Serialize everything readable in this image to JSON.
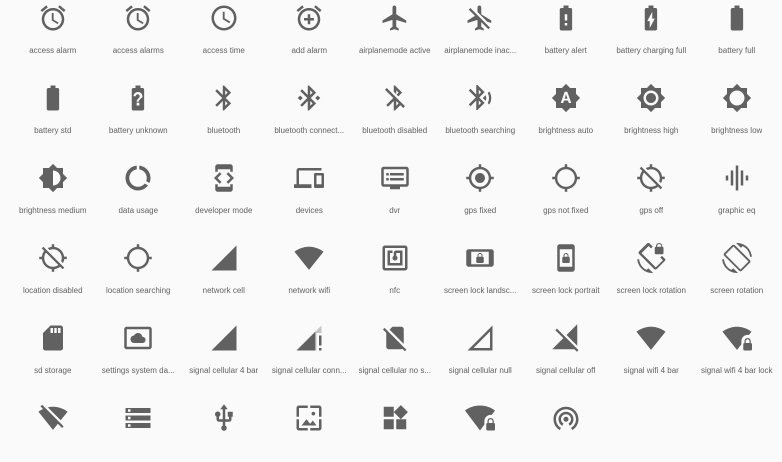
{
  "icons": [
    {
      "label": "access alarm",
      "icon": "alarm-icon"
    },
    {
      "label": "access alarms",
      "icon": "alarms-icon"
    },
    {
      "label": "access time",
      "icon": "time-icon"
    },
    {
      "label": "add alarm",
      "icon": "add-alarm-icon"
    },
    {
      "label": "airplanemode active",
      "icon": "airplane-icon"
    },
    {
      "label": "airplanemode inac...",
      "icon": "airplane-off-icon"
    },
    {
      "label": "battery alert",
      "icon": "battery-alert-icon"
    },
    {
      "label": "battery charging full",
      "icon": "battery-charging-icon"
    },
    {
      "label": "battery full",
      "icon": "battery-full-icon"
    },
    {
      "label": "battery std",
      "icon": "battery-std-icon"
    },
    {
      "label": "battery unknown",
      "icon": "battery-unknown-icon"
    },
    {
      "label": "bluetooth",
      "icon": "bluetooth-icon"
    },
    {
      "label": "bluetooth connect...",
      "icon": "bluetooth-connected-icon"
    },
    {
      "label": "bluetooth disabled",
      "icon": "bluetooth-disabled-icon"
    },
    {
      "label": "bluetooth searching",
      "icon": "bluetooth-searching-icon"
    },
    {
      "label": "brightness auto",
      "icon": "brightness-auto-icon"
    },
    {
      "label": "brightness high",
      "icon": "brightness-high-icon"
    },
    {
      "label": "brightness low",
      "icon": "brightness-low-icon"
    },
    {
      "label": "brightness medium",
      "icon": "brightness-medium-icon"
    },
    {
      "label": "data usage",
      "icon": "data-usage-icon"
    },
    {
      "label": "developer mode",
      "icon": "developer-mode-icon"
    },
    {
      "label": "devices",
      "icon": "devices-icon"
    },
    {
      "label": "dvr",
      "icon": "dvr-icon"
    },
    {
      "label": "gps fixed",
      "icon": "gps-fixed-icon"
    },
    {
      "label": "gps not fixed",
      "icon": "gps-not-fixed-icon"
    },
    {
      "label": "gps off",
      "icon": "gps-off-icon"
    },
    {
      "label": "graphic eq",
      "icon": "graphic-eq-icon"
    },
    {
      "label": "location disabled",
      "icon": "location-disabled-icon"
    },
    {
      "label": "location searching",
      "icon": "location-searching-icon"
    },
    {
      "label": "network cell",
      "icon": "network-cell-icon"
    },
    {
      "label": "network wifi",
      "icon": "network-wifi-icon"
    },
    {
      "label": "nfc",
      "icon": "nfc-icon"
    },
    {
      "label": "screen lock landsc...",
      "icon": "screen-lock-landscape-icon"
    },
    {
      "label": "screen lock portrait",
      "icon": "screen-lock-portrait-icon"
    },
    {
      "label": "screen lock rotation",
      "icon": "screen-lock-rotation-icon"
    },
    {
      "label": "screen rotation",
      "icon": "screen-rotation-icon"
    },
    {
      "label": "sd storage",
      "icon": "sd-storage-icon"
    },
    {
      "label": "settings system da...",
      "icon": "settings-system-daydream-icon"
    },
    {
      "label": "signal cellular 4 bar",
      "icon": "signal-cellular-4-bar-icon"
    },
    {
      "label": "signal cellular conn...",
      "icon": "signal-cellular-connected-icon"
    },
    {
      "label": "signal cellular no s...",
      "icon": "signal-cellular-no-sim-icon"
    },
    {
      "label": "signal cellular null",
      "icon": "signal-cellular-null-icon"
    },
    {
      "label": "signal cellular off",
      "icon": "signal-cellular-off-icon"
    },
    {
      "label": "signal wifi 4 bar",
      "icon": "signal-wifi-4-bar-icon"
    },
    {
      "label": "signal wifi 4 bar lock",
      "icon": "signal-wifi-4-bar-lock-icon"
    },
    {
      "label": "",
      "icon": "signal-wifi-off-icon"
    },
    {
      "label": "",
      "icon": "storage-icon"
    },
    {
      "label": "",
      "icon": "usb-icon"
    },
    {
      "label": "",
      "icon": "wallpaper-icon"
    },
    {
      "label": "",
      "icon": "widgets-icon"
    },
    {
      "label": "",
      "icon": "wifi-lock-icon"
    },
    {
      "label": "",
      "icon": "wifi-tethering-icon"
    }
  ]
}
